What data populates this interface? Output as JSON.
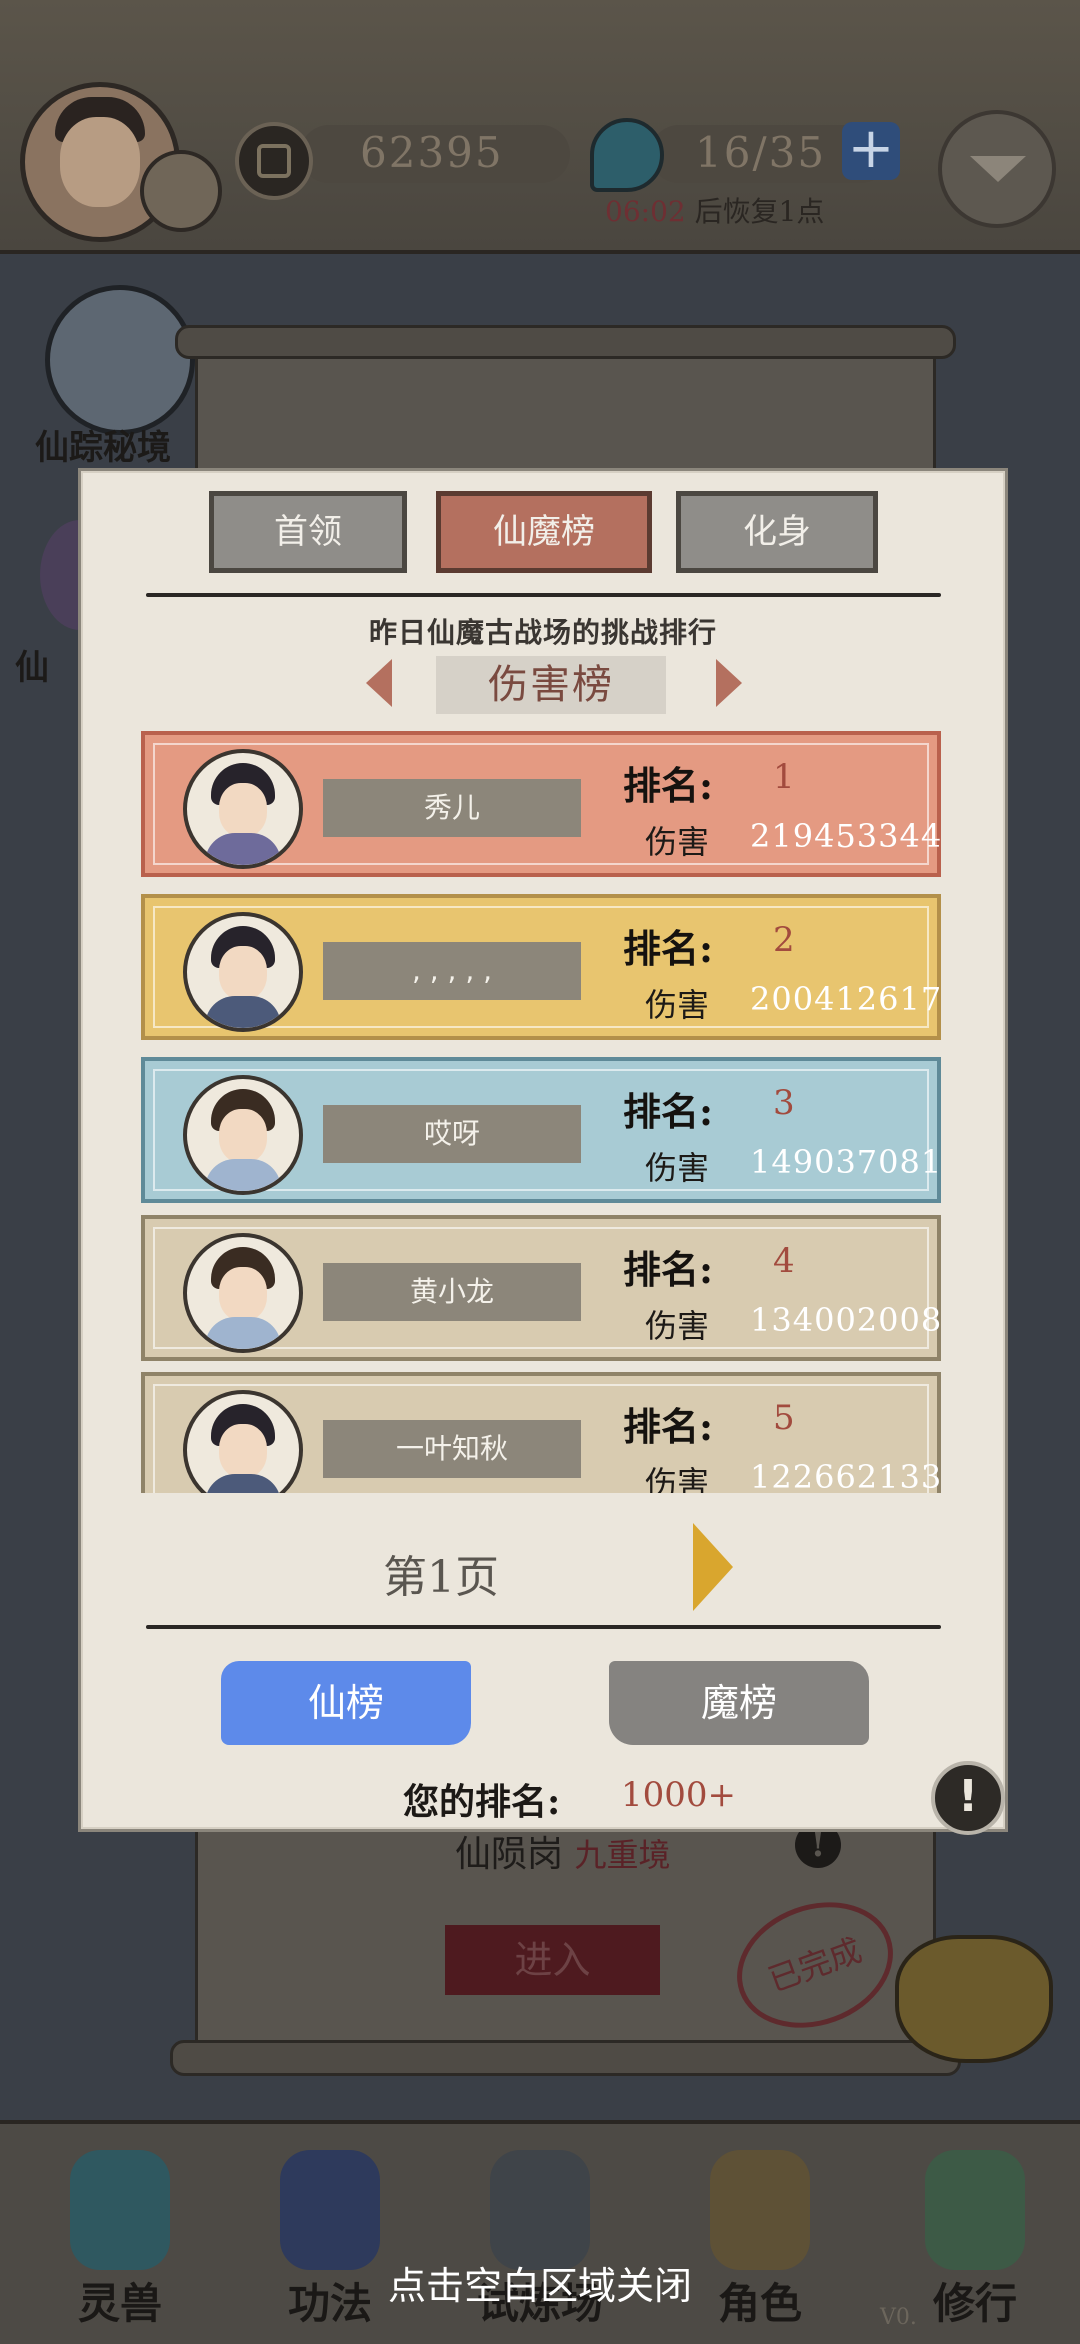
{
  "header": {
    "coins": "62395",
    "stamina": "16/35",
    "plus_label": "+",
    "recover_time": "06:02",
    "recover_text": "后恢复1点"
  },
  "side": {
    "item1_label": "仙踪秘境",
    "item2_label": "仙"
  },
  "background": {
    "realm_name": "仙陨岗",
    "realm_level": "九重境",
    "enter_label": "进入",
    "done_stamp": "已完成",
    "info": "!"
  },
  "dialog": {
    "tabs": [
      {
        "label": "首领"
      },
      {
        "label": "仙魔榜"
      },
      {
        "label": "化身"
      }
    ],
    "subtitle": "昨日仙魔古战场的挑战排行",
    "board_title": "伤害榜",
    "rank_label": "排名:",
    "damage_label": "伤害",
    "entries": [
      {
        "name": "秀儿",
        "rank": "1",
        "damage": "219453344"
      },
      {
        "name": ",  ,  ,  ,  ,",
        "rank": "2",
        "damage": "200412617"
      },
      {
        "name": "哎呀",
        "rank": "3",
        "damage": "149037081"
      },
      {
        "name": "黄小龙",
        "rank": "4",
        "damage": "134002008"
      },
      {
        "name": "一叶知秋",
        "rank": "5",
        "damage": "122662133"
      }
    ],
    "page_label": "第1页",
    "xian_label": "仙榜",
    "mo_label": "魔榜",
    "my_rank_label": "您的排名:",
    "my_rank_value": "1000+",
    "info": "!"
  },
  "bottom_nav": [
    {
      "label": "灵兽"
    },
    {
      "label": "功法"
    },
    {
      "label": "试炼场"
    },
    {
      "label": "角色"
    },
    {
      "label": "修行"
    }
  ],
  "close_hint": "点击空白区域关闭",
  "version": "V0."
}
